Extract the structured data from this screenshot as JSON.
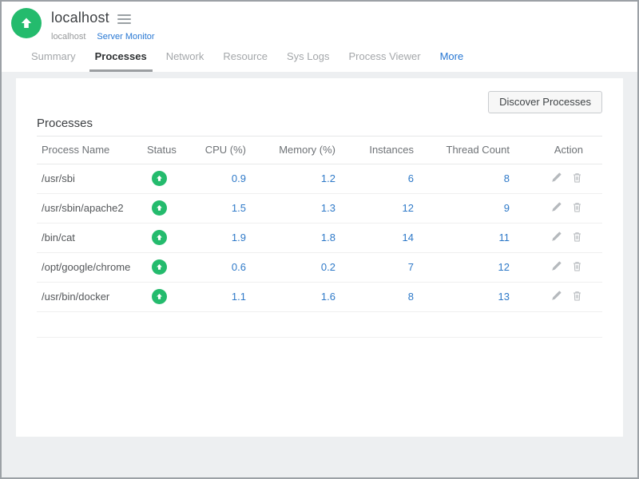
{
  "header": {
    "title": "localhost",
    "breadcrumb_host": "localhost",
    "breadcrumb_link": "Server Monitor"
  },
  "tabs": [
    {
      "label": "Summary"
    },
    {
      "label": "Processes",
      "active": true
    },
    {
      "label": "Network"
    },
    {
      "label": "Resource"
    },
    {
      "label": "Sys Logs"
    },
    {
      "label": "Process Viewer"
    },
    {
      "label": "More"
    }
  ],
  "toolbar": {
    "discover_button": "Discover Processes"
  },
  "section": {
    "title": "Processes"
  },
  "table": {
    "columns": [
      "Process Name",
      "Status",
      "CPU (%)",
      "Memory (%)",
      "Instances",
      "Thread Count",
      "Action"
    ],
    "rows": [
      {
        "name": "/usr/sbi",
        "status": "up",
        "cpu": "0.9",
        "memory": "1.2",
        "instances": "6",
        "threads": "8"
      },
      {
        "name": "/usr/sbin/apache2",
        "status": "up",
        "cpu": "1.5",
        "memory": "1.3",
        "instances": "12",
        "threads": "9"
      },
      {
        "name": "/bin/cat",
        "status": "up",
        "cpu": "1.9",
        "memory": "1.8",
        "instances": "14",
        "threads": "11"
      },
      {
        "name": "/opt/google/chrome",
        "status": "up",
        "cpu": "0.6",
        "memory": "0.2",
        "instances": "7",
        "threads": "12"
      },
      {
        "name": "/usr/bin/docker",
        "status": "up",
        "cpu": "1.1",
        "memory": "1.6",
        "instances": "8",
        "threads": "13"
      }
    ]
  },
  "colors": {
    "green": "#24bb6d",
    "blue": "#2e79c8",
    "page_bg": "#edeff1"
  }
}
